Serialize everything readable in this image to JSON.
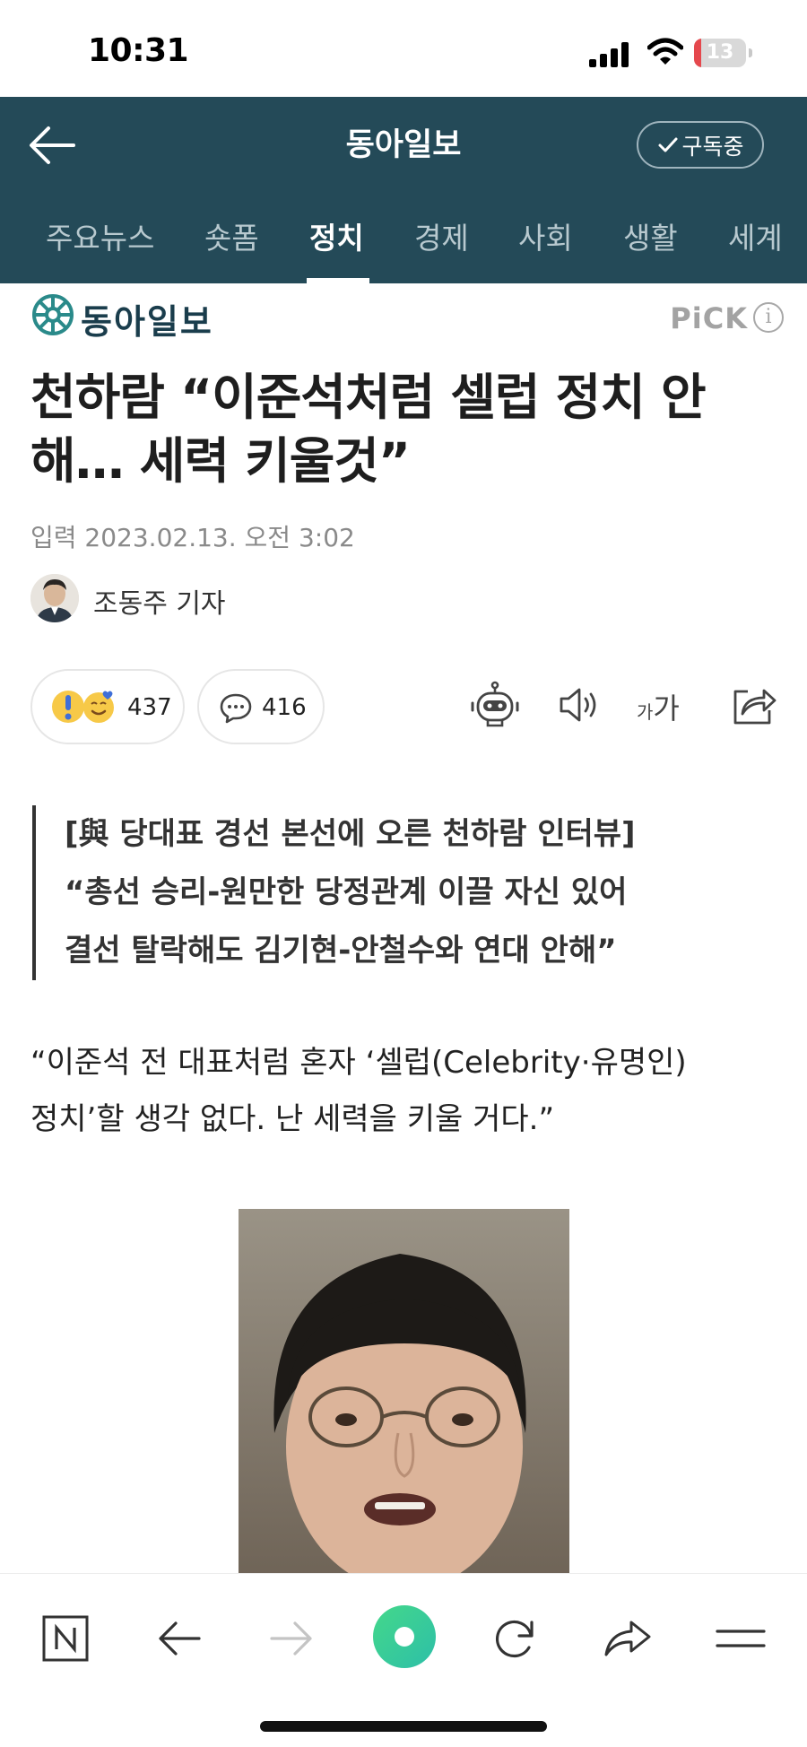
{
  "status_bar": {
    "time": "10:31",
    "battery_level": "13",
    "battery_fraction": 0.13
  },
  "header": {
    "title": "동아일보",
    "subscribe_label": "구독중"
  },
  "tabs": [
    {
      "label": "주요뉴스"
    },
    {
      "label": "숏폼"
    },
    {
      "label": "정치",
      "active": true
    },
    {
      "label": "경제"
    },
    {
      "label": "사회"
    },
    {
      "label": "생활"
    },
    {
      "label": "세계"
    }
  ],
  "press": {
    "name": "동아일보",
    "pick_label": "PiCK",
    "info_icon": "i"
  },
  "article": {
    "headline_line1": "천하람 “이준석처럼 셀럽 정치 안",
    "headline_line2": "해… 세력 키울것”",
    "date": "입력 2023.02.13. 오전 3:02",
    "author": "조동주 기자",
    "reaction_count": "437",
    "comment_count": "416",
    "font_size_small": "가",
    "font_size_large": "가",
    "summary_lines": [
      "[與 당대표 경선 본선에 오른 천하람 인터뷰]",
      "“총선 승리-원만한 당정관계 이끌 자신 있어",
      "결선 탈락해도 김기현-안철수와 연대 안해”"
    ],
    "body_line1": "“이준석 전 대표처럼 혼자 ‘셀럽(Celebrity·유명인)",
    "body_line2": "정치’할 생각 없다. 난 세력을 키울 거다.”"
  },
  "icons": {
    "back": "back-arrow-icon",
    "subscribe_check": "check-icon",
    "ai_summary": "robot-icon",
    "tts": "speaker-icon",
    "font_size": "font-size-icon",
    "share": "share-icon",
    "comment": "speech-bubble-icon",
    "nav": [
      "naver-n-icon",
      "back-arrow-icon",
      "forward-arrow-icon",
      "green-dot-icon",
      "refresh-icon",
      "share-arrow-icon",
      "menu-icon"
    ]
  },
  "colors": {
    "header_bg": "#244a58",
    "green_button": "#3ecf8e",
    "battery_low": "#e5484d"
  }
}
